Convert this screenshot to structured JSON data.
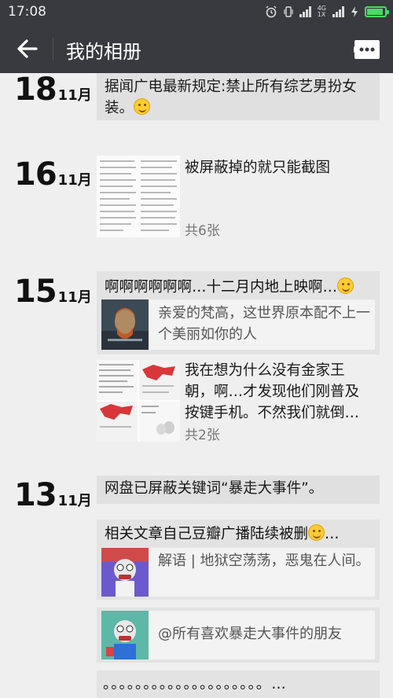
{
  "status": {
    "time": "17:08",
    "network_top": "4G",
    "network_bottom": "1X"
  },
  "toolbar": {
    "title": "我的相册",
    "back_icon": "back-arrow-icon",
    "message_icon": "message-icon"
  },
  "entries": [
    {
      "day": "18",
      "month": "11月",
      "text": "据闻广电最新规定:禁止所有综艺男扮女装。"
    },
    {
      "day": "16",
      "month": "11月",
      "text": "被屏蔽掉的就只能截图",
      "count": "共6张"
    },
    {
      "day": "15",
      "month": "11月",
      "share_title": "啊啊啊啊啊啊…十二月内地上映啊…",
      "share_text": "亲爱的梵高，这世界原本配不上一个美丽如你的人",
      "text": "我在想为什么没有金家王朝，啊…才发现他们刚普及按键手机。不然我们就倒…",
      "count": "共2张"
    },
    {
      "day": "13",
      "month": "11月",
      "text": "网盘已屏蔽关键词“暴走大事件”。",
      "share_title": "相关文章自己豆瓣广播陆续被删",
      "share_text": "解语 | 地狱空荡荡，恶鬼在人间。",
      "share2_text": "@所有喜欢暴走大事件的朋友",
      "dots": "。。。。。。。。。。。。。。。。。。。。…"
    }
  ],
  "colors": {
    "bar": "#393a3f",
    "background": "#efefef",
    "card": "#e0e0e0"
  }
}
